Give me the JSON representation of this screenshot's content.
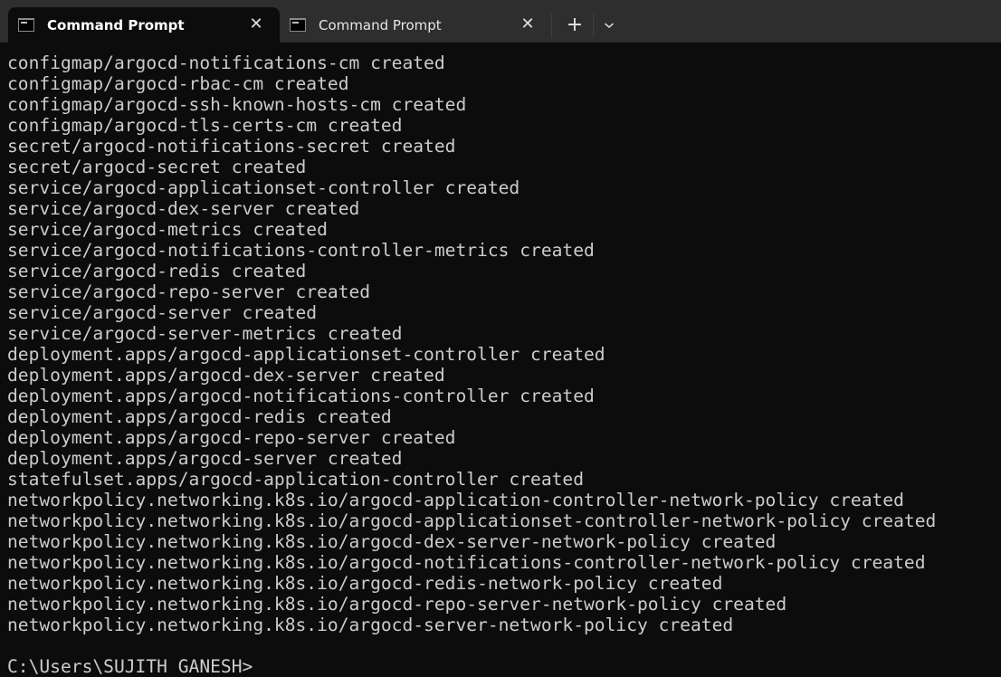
{
  "tabs": [
    {
      "label": "Command Prompt",
      "active": true,
      "icon": "cmd-icon"
    },
    {
      "label": "Command Prompt",
      "active": false,
      "icon": "cmd-icon"
    }
  ],
  "tabbar": {
    "new_tab_symbol": "+",
    "close_symbol": "✕"
  },
  "terminal": {
    "lines": [
      "configmap/argocd-notifications-cm created",
      "configmap/argocd-rbac-cm created",
      "configmap/argocd-ssh-known-hosts-cm created",
      "configmap/argocd-tls-certs-cm created",
      "secret/argocd-notifications-secret created",
      "secret/argocd-secret created",
      "service/argocd-applicationset-controller created",
      "service/argocd-dex-server created",
      "service/argocd-metrics created",
      "service/argocd-notifications-controller-metrics created",
      "service/argocd-redis created",
      "service/argocd-repo-server created",
      "service/argocd-server created",
      "service/argocd-server-metrics created",
      "deployment.apps/argocd-applicationset-controller created",
      "deployment.apps/argocd-dex-server created",
      "deployment.apps/argocd-notifications-controller created",
      "deployment.apps/argocd-redis created",
      "deployment.apps/argocd-repo-server created",
      "deployment.apps/argocd-server created",
      "statefulset.apps/argocd-application-controller created",
      "networkpolicy.networking.k8s.io/argocd-application-controller-network-policy created",
      "networkpolicy.networking.k8s.io/argocd-applicationset-controller-network-policy created",
      "networkpolicy.networking.k8s.io/argocd-dex-server-network-policy created",
      "networkpolicy.networking.k8s.io/argocd-notifications-controller-network-policy created",
      "networkpolicy.networking.k8s.io/argocd-redis-network-policy created",
      "networkpolicy.networking.k8s.io/argocd-repo-server-network-policy created",
      "networkpolicy.networking.k8s.io/argocd-server-network-policy created",
      ""
    ],
    "prompt": "C:\\Users\\SUJITH GANESH>"
  }
}
